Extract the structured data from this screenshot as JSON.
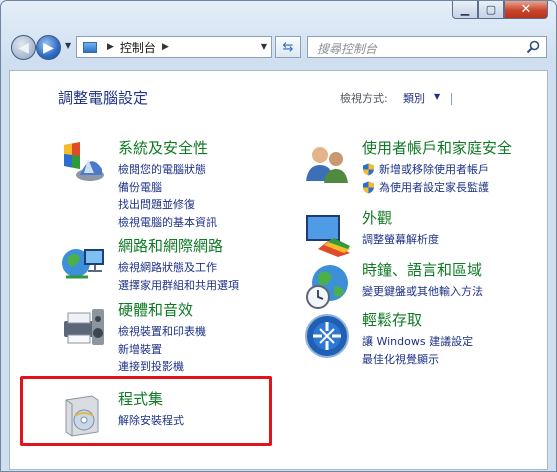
{
  "window": {
    "minimize_glyph": "▁",
    "maximize_glyph": "▢",
    "close_glyph": "✕"
  },
  "nav": {
    "address": "控制台",
    "search_placeholder": "搜尋控制台"
  },
  "main": {
    "heading": "調整電腦設定",
    "view_label": "檢視方式:",
    "view_value": "類別"
  },
  "categories_left": [
    {
      "title": "系統及安全性",
      "icon": "system-security-icon",
      "links": [
        "檢閱您的電腦狀態",
        "備份電腦",
        "找出問題並修復",
        "檢視電腦的基本資訊"
      ]
    },
    {
      "title": "網路和網際網路",
      "icon": "network-icon",
      "links": [
        "檢視網路狀態及工作",
        "選擇家用群組和共用選項"
      ]
    },
    {
      "title": "硬體和音效",
      "icon": "hardware-sound-icon",
      "links": [
        "檢視裝置和印表機",
        "新增裝置",
        "連接到投影機"
      ]
    },
    {
      "title": "程式集",
      "icon": "programs-icon",
      "links": [
        "解除安裝程式"
      ]
    }
  ],
  "categories_right": [
    {
      "title": "使用者帳戶和家庭安全",
      "icon": "user-accounts-icon",
      "links": [
        "新增或移除使用者帳戶",
        "為使用者設定家長監護"
      ]
    },
    {
      "title": "外觀",
      "icon": "appearance-icon",
      "links": [
        "調整螢幕解析度"
      ]
    },
    {
      "title": "時鐘、語言和區域",
      "icon": "clock-language-icon",
      "links": [
        "變更鍵盤或其他輸入方法"
      ]
    },
    {
      "title": "輕鬆存取",
      "icon": "ease-of-access-icon",
      "links": [
        "讓 Windows 建議設定",
        "最佳化視覺顯示"
      ]
    }
  ],
  "colors": {
    "link": "#1e3287",
    "category_title": "#0f7a24",
    "highlight_box": "#e1131b"
  }
}
